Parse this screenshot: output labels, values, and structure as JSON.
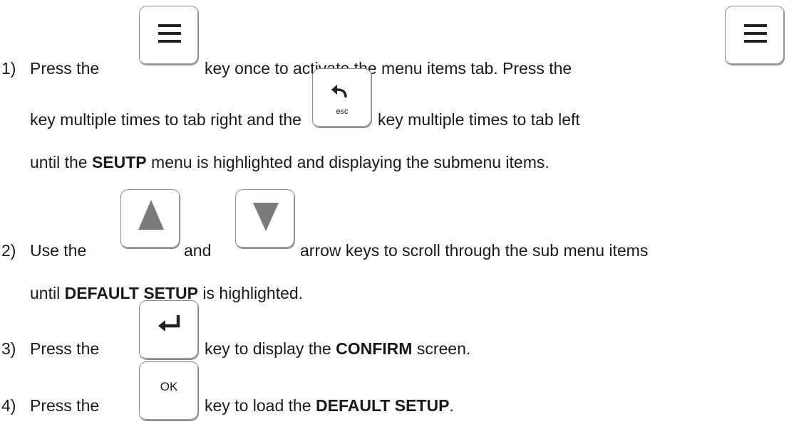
{
  "steps": [
    {
      "number": "1)",
      "line1": {
        "a": "Press the",
        "b": "key once to activate the menu items tab.  Press the"
      },
      "line2": {
        "a": "key multiple times to tab right and the",
        "b": "key multiple times to tab left"
      },
      "line3": {
        "a": "until the",
        "bold": "SEUTP",
        "b": "menu is highlighted and displaying the submenu items."
      }
    },
    {
      "number": "2)",
      "line1": {
        "a": "Use the",
        "b": "and",
        "c": "arrow keys to scroll through the sub menu items"
      },
      "line2": {
        "a": "until",
        "bold": "DEFAULT SETUP",
        "b": "is highlighted."
      }
    },
    {
      "number": "3)",
      "line1": {
        "a": "Press the",
        "b": "key to display the",
        "bold": "CONFIRM",
        "c": "screen."
      }
    },
    {
      "number": "4)",
      "line1": {
        "a": "Press the",
        "b": "key to load the",
        "bold": "DEFAULT SETUP",
        "c": "."
      }
    }
  ],
  "keys": {
    "menu": {
      "icon": "menu-icon"
    },
    "esc": {
      "icon": "back-arrow-icon",
      "label": "esc"
    },
    "up": {
      "icon": "triangle-up-icon"
    },
    "down": {
      "icon": "triangle-down-icon"
    },
    "enter": {
      "icon": "enter-icon"
    },
    "ok": {
      "label": "OK"
    }
  },
  "colors": {
    "text": "#1a1a1a",
    "key_border": "#8a8a8a",
    "triangle": "#7a7a7a"
  }
}
